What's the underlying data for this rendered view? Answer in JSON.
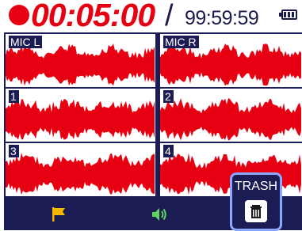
{
  "header": {
    "elapsed_time": "00:05:00",
    "separator": "/",
    "remaining_time": "99:59:59",
    "battery_bars": 3
  },
  "tracks": [
    {
      "label": "MIC L"
    },
    {
      "label": "MIC R"
    },
    {
      "label": "1"
    },
    {
      "label": "2"
    },
    {
      "label": "3"
    },
    {
      "label": "4"
    }
  ],
  "footer": {
    "icons": [
      "flag-icon",
      "speaker-icon"
    ],
    "trash_label": "TRASH"
  },
  "colors": {
    "record": "#e60012",
    "panel": "#1c1c55",
    "highlight": "#8aa8ff"
  }
}
